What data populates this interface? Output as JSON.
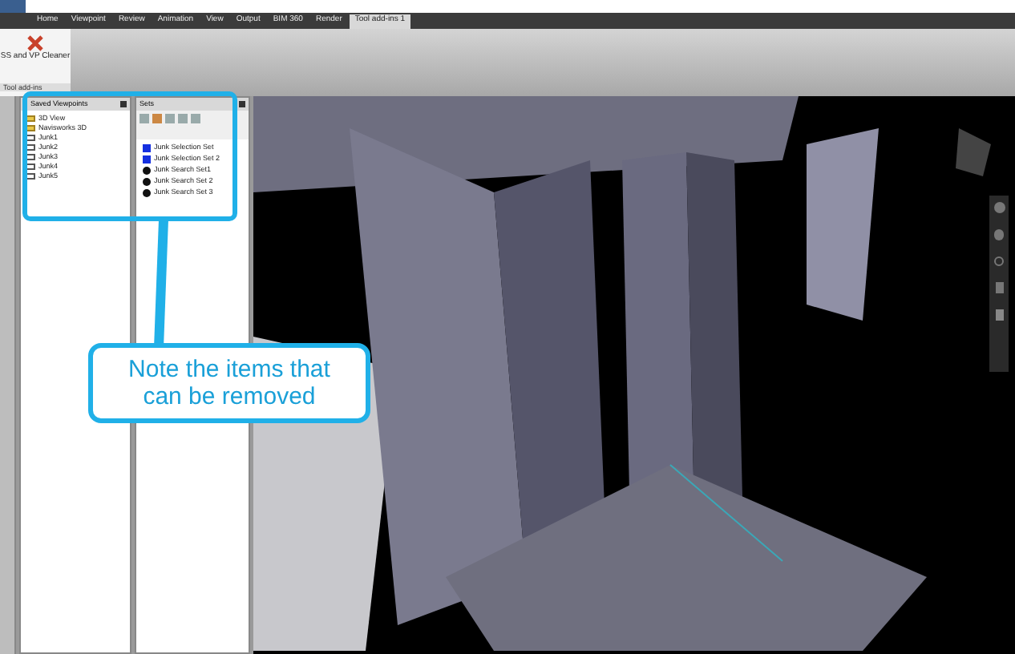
{
  "ribbon": {
    "tabs": [
      {
        "label": "Home",
        "selected": false
      },
      {
        "label": "Viewpoint",
        "selected": false
      },
      {
        "label": "Review",
        "selected": false
      },
      {
        "label": "Animation",
        "selected": false
      },
      {
        "label": "View",
        "selected": false
      },
      {
        "label": "Output",
        "selected": false
      },
      {
        "label": "BIM 360",
        "selected": false
      },
      {
        "label": "Render",
        "selected": false
      },
      {
        "label": "Tool add-ins 1",
        "selected": true
      }
    ],
    "button": "SS and VP Cleaner",
    "panel_label": "Tool add-ins"
  },
  "saved_viewpoints": {
    "title": "Saved Viewpoints",
    "items": [
      {
        "label": "3D View",
        "kind": "folder"
      },
      {
        "label": "Navisworks 3D",
        "kind": "folder"
      },
      {
        "label": "Junk1",
        "kind": "viewpoint"
      },
      {
        "label": "Junk2",
        "kind": "viewpoint"
      },
      {
        "label": "Junk3",
        "kind": "viewpoint"
      },
      {
        "label": "Junk4",
        "kind": "viewpoint"
      },
      {
        "label": "Junk5",
        "kind": "viewpoint"
      }
    ]
  },
  "sets": {
    "title": "Sets",
    "items": [
      {
        "label": "Junk Selection Set",
        "kind": "selection"
      },
      {
        "label": "Junk Selection Set 2",
        "kind": "selection"
      },
      {
        "label": "Junk Search Set1",
        "kind": "search"
      },
      {
        "label": "Junk Search Set 2",
        "kind": "search"
      },
      {
        "label": "Junk Search Set 3",
        "kind": "search"
      }
    ]
  },
  "callout": {
    "text": "Note the items that can be removed"
  }
}
